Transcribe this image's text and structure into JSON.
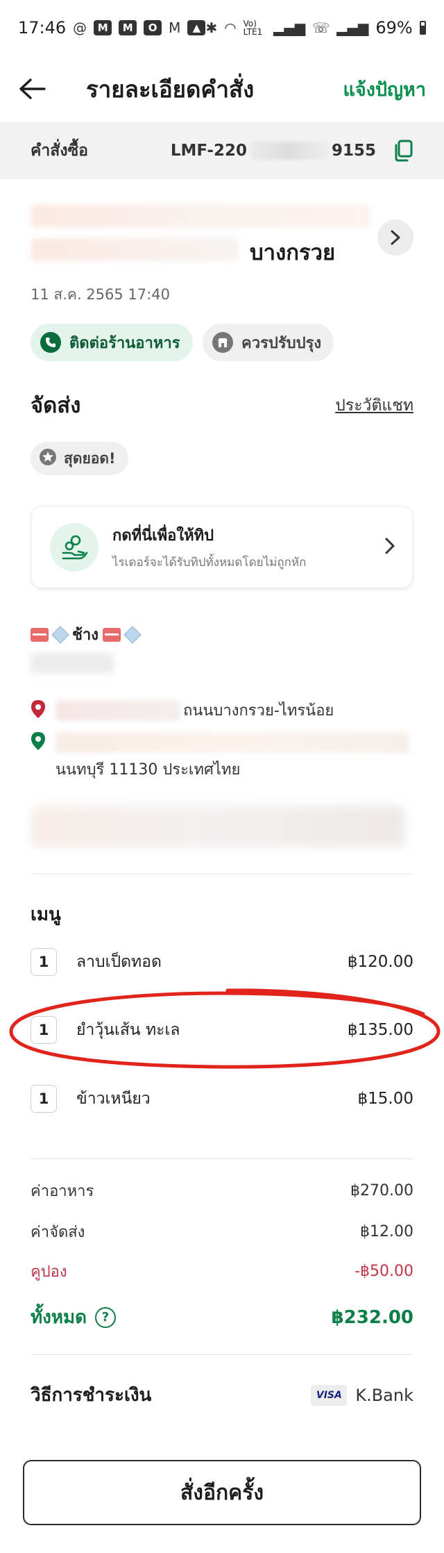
{
  "status_bar": {
    "time": "17:46",
    "left_icons": [
      "threads-icon",
      "gmail-icon",
      "gmail-icon",
      "outlook-icon",
      "gmail-icon",
      "gallery-icon"
    ],
    "network": "Vo) LTE1",
    "battery": "69%"
  },
  "header": {
    "title": "รายละเอียดคำสั่ง",
    "report_link": "แจ้งปัญหา"
  },
  "order": {
    "label": "คำสั่งซื้อ",
    "id_prefix": "LMF-220",
    "id_suffix": "9155"
  },
  "restaurant": {
    "name_suffix": "บางกรวย",
    "datetime": "11 ส.ค. 2565 17:40",
    "contact_chip": "ติดต่อร้านอาหาร",
    "improve_chip": "ควรปรับปรุง"
  },
  "delivery": {
    "title": "จัดส่ง",
    "chat_history": "ประวัติแชท",
    "rating_badge": "สุดยอด!",
    "tip_title": "กดที่นี่เพื่อให้ทิป",
    "tip_subtitle": "ไรเดอร์จะได้รับทิปทั้งหมดโดยไม่ถูกหัก",
    "rider_name": "ช้าง",
    "pickup_address": "ถนนบางกรวย-ไทรน้อย",
    "dropoff_address_line2": "นนทบุรี 11130 ประเทศไทย"
  },
  "menu": {
    "title": "เมนู",
    "items": [
      {
        "qty": "1",
        "name": "ลาบเป็ดทอด",
        "price": "฿120.00"
      },
      {
        "qty": "1",
        "name": "ยำวุ้นเส้น ทะเล",
        "price": "฿135.00"
      },
      {
        "qty": "1",
        "name": "ข้าวเหนียว",
        "price": "฿15.00"
      }
    ]
  },
  "summary": {
    "food_label": "ค่าอาหาร",
    "food_value": "฿270.00",
    "delivery_label": "ค่าจัดส่ง",
    "delivery_value": "฿12.00",
    "coupon_label": "คูปอง",
    "coupon_value": "-฿50.00",
    "total_label": "ทั้งหมด",
    "total_value": "฿232.00"
  },
  "payment": {
    "label": "วิธีการชำระเงิน",
    "card_brand": "VISA",
    "bank": "K.Bank"
  },
  "actions": {
    "reorder": "สั่งอีกครั้ง"
  },
  "colors": {
    "brand_green": "#0a8f4f",
    "coupon_red": "#c1344a",
    "annotation_red": "#e0241b"
  }
}
